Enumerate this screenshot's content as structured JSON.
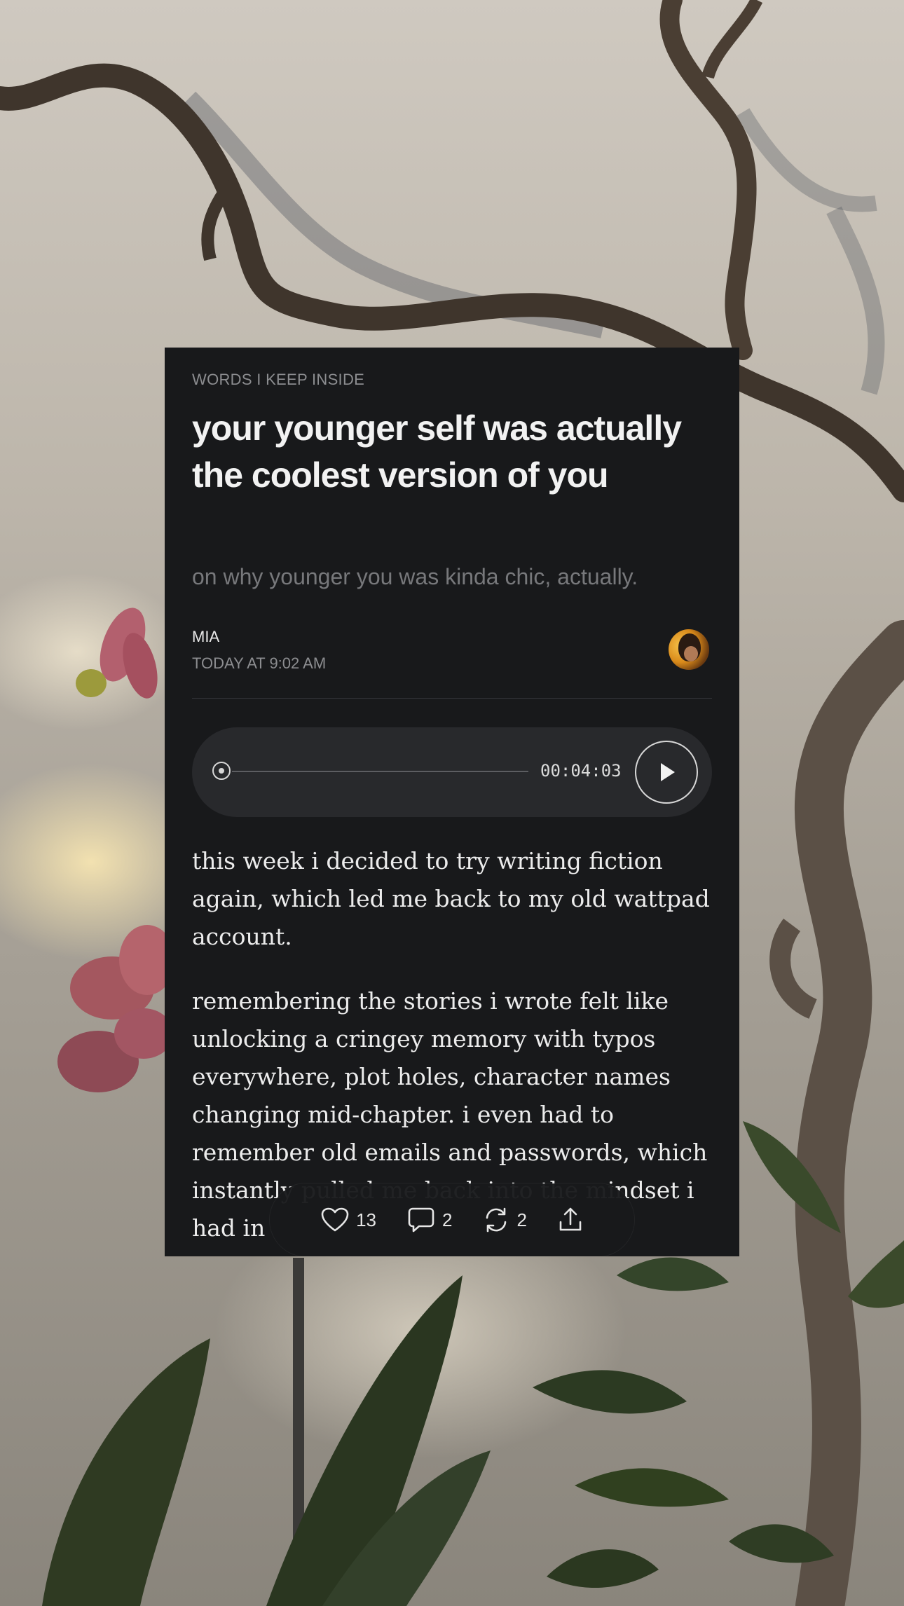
{
  "post": {
    "publication": "WORDS I KEEP INSIDE",
    "title": "your younger self was actually the coolest version of you",
    "subtitle": "on why younger you was kinda chic, actually.",
    "author": "MIA",
    "date": "TODAY AT 9:02 AM"
  },
  "audio": {
    "duration": "00:04:03",
    "progress": 0
  },
  "body": {
    "paragraphs": [
      "this week i decided to try writing fiction again, which led me back to my old wattpad account.",
      "remembering the stories i wrote felt like unlocking a cringey memory with typos everywhere, plot holes, character names changing mid-chapter. i even had to remember old emails and passwords, which instantly pulled me back into the mindset i had in"
    ]
  },
  "actions": {
    "likes": "13",
    "comments": "2",
    "restacks": "2"
  },
  "icons": {
    "like": "heart-icon",
    "comment": "comment-bubble-icon",
    "restack": "restack-arrows-icon",
    "share": "share-icon",
    "play": "play-icon"
  },
  "colors": {
    "card_bg": "#18191b",
    "player_bg": "#28292c",
    "title": "#f2f2f2",
    "muted": "#8c8d90"
  }
}
